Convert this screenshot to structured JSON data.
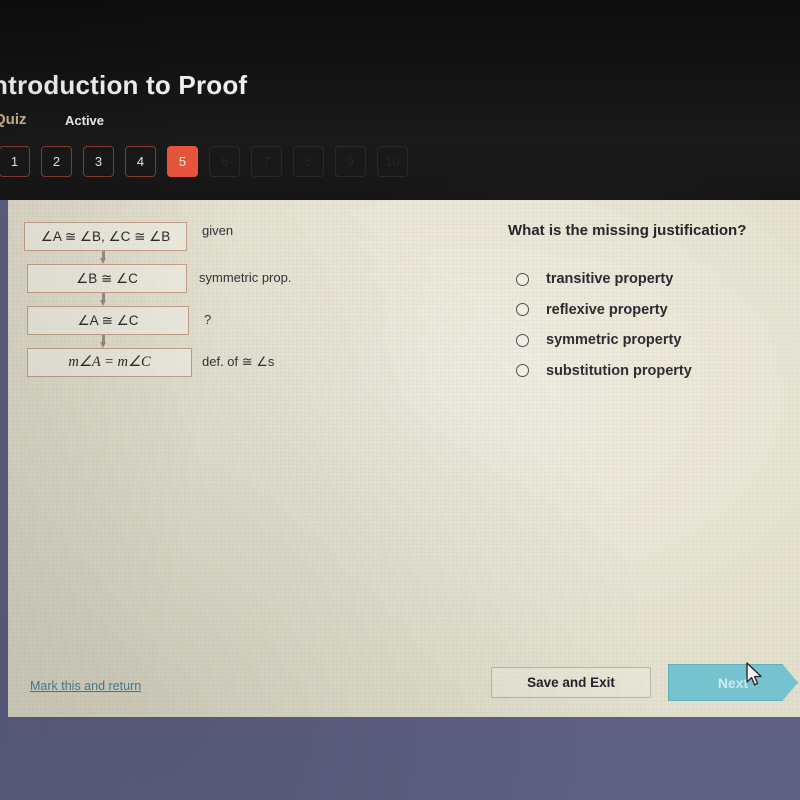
{
  "header": {
    "course_title": "ntroduction to Proof",
    "quiz_label": "Quiz",
    "status_label": "Active",
    "question_numbers": [
      {
        "label": "1",
        "state": "available"
      },
      {
        "label": "2",
        "state": "available"
      },
      {
        "label": "3",
        "state": "available"
      },
      {
        "label": "4",
        "state": "available"
      },
      {
        "label": "5",
        "state": "current"
      },
      {
        "label": "6",
        "state": "locked"
      },
      {
        "label": "7",
        "state": "locked"
      },
      {
        "label": "8",
        "state": "locked"
      },
      {
        "label": "9",
        "state": "locked"
      },
      {
        "label": "10",
        "state": "locked"
      }
    ]
  },
  "proof": {
    "steps": [
      {
        "statement": "∠A ≅ ∠B, ∠C ≅ ∠B",
        "reason": "given"
      },
      {
        "statement": "∠B ≅ ∠C",
        "reason": "symmetric prop."
      },
      {
        "statement": "∠A ≅ ∠C",
        "reason": "?"
      },
      {
        "statement": "m∠A = m∠C",
        "reason": "def. of ≅  ∠s"
      }
    ]
  },
  "question": {
    "prompt": "What is the missing justification?",
    "choices": [
      "transitive property",
      "reflexive property",
      "symmetric property",
      "substitution property"
    ],
    "selected": null
  },
  "footer": {
    "mark_link": "Mark this and return",
    "save_label": "Save and Exit",
    "next_label": "Next"
  },
  "colors": {
    "chrome": "#141414",
    "current_question": "#e8563c",
    "panel": "#e8e5d4",
    "next_button": "#74c3ce",
    "link": "#4b87a0",
    "desktop": "#5e6183"
  }
}
